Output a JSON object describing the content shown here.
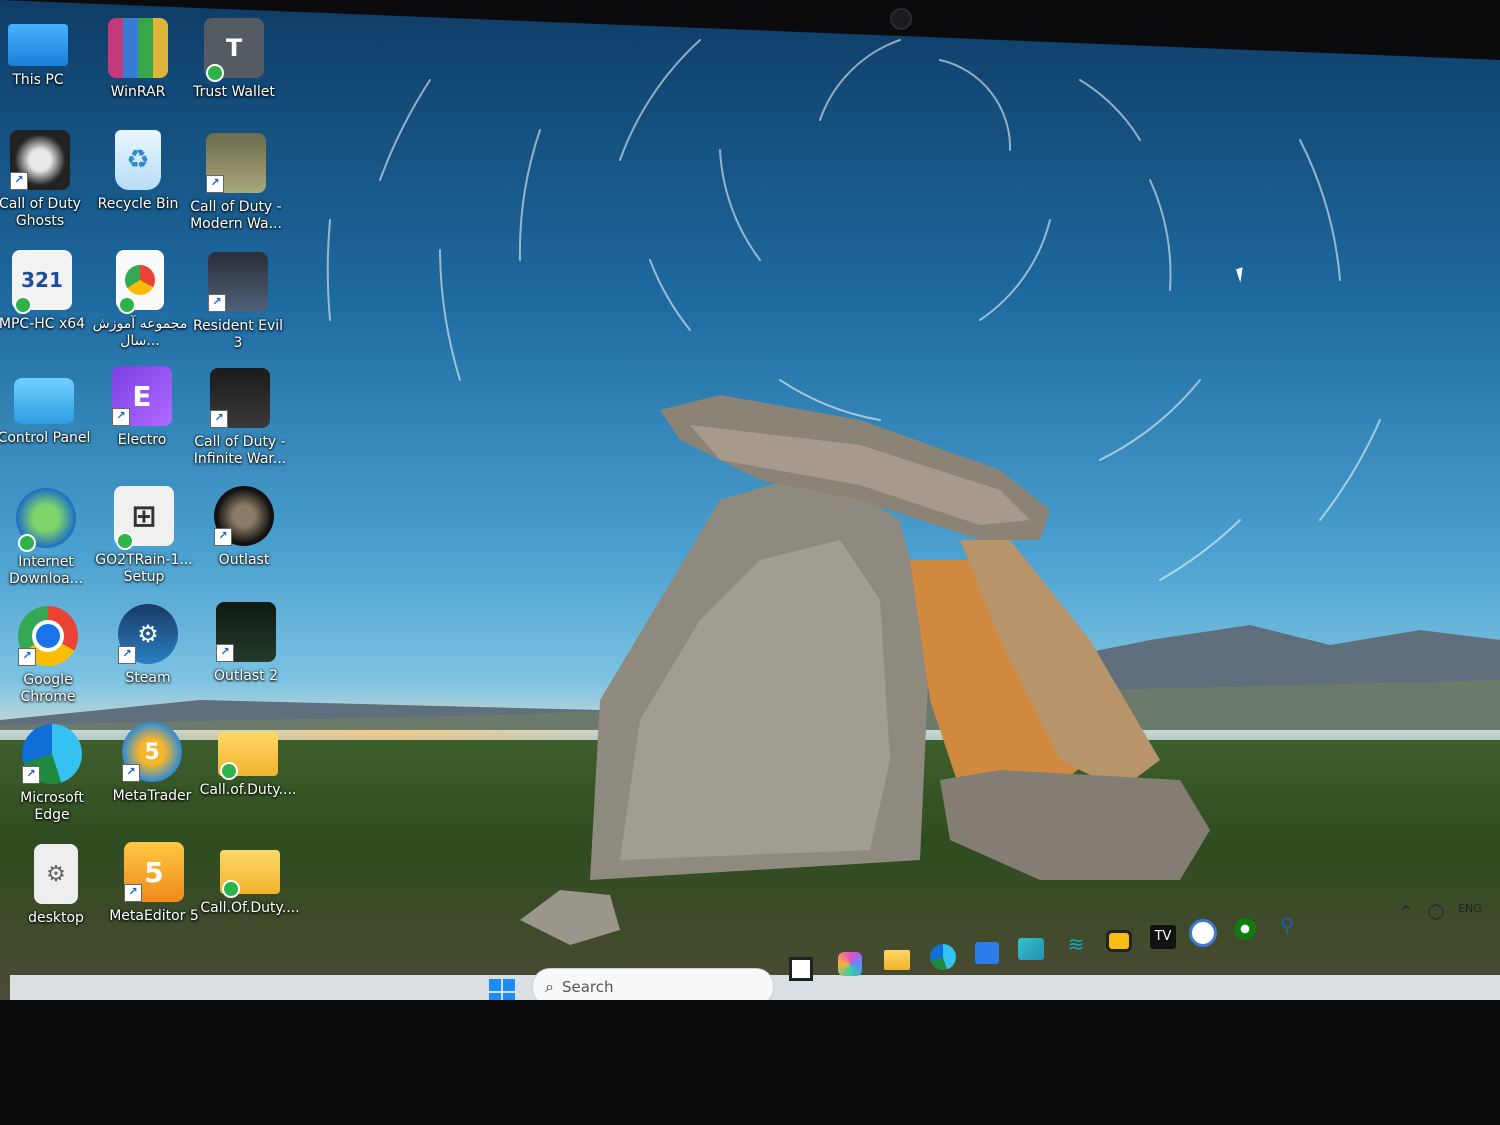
{
  "desktop": {
    "icons": [
      {
        "label": "This PC",
        "icon": "monitor-icon"
      },
      {
        "label": "WinRAR",
        "icon": "winrar-icon"
      },
      {
        "label": "Trust Wallet",
        "icon": "trust-wallet-icon",
        "glyph": "T"
      },
      {
        "label": "Call of Duty Ghosts",
        "icon": "cod-ghosts-icon"
      },
      {
        "label": "Recycle Bin",
        "icon": "recycle-bin-icon"
      },
      {
        "label": "Call of Duty - Modern Wa...",
        "icon": "cod-mw-icon"
      },
      {
        "label": "MPC-HC x64",
        "icon": "mpc-hc-icon",
        "glyph": "321"
      },
      {
        "label": "مجموعه آموزش سال...",
        "icon": "chrome-file-icon"
      },
      {
        "label": "Resident Evil 3",
        "icon": "resident-evil-icon"
      },
      {
        "label": "Control Panel",
        "icon": "control-panel-icon"
      },
      {
        "label": "Electro",
        "icon": "electro-icon",
        "glyph": "E"
      },
      {
        "label": "Call of Duty - Infinite War...",
        "icon": "cod-iw-icon"
      },
      {
        "label": "Internet Downloa...",
        "icon": "idm-icon"
      },
      {
        "label": "GO2TRain-1... Setup",
        "icon": "installer-icon"
      },
      {
        "label": "Outlast",
        "icon": "outlast-icon"
      },
      {
        "label": "Google Chrome",
        "icon": "chrome-icon"
      },
      {
        "label": "Steam",
        "icon": "steam-icon"
      },
      {
        "label": "Outlast 2",
        "icon": "outlast2-icon"
      },
      {
        "label": "Microsoft Edge",
        "icon": "edge-icon"
      },
      {
        "label": "MetaTrader",
        "icon": "metatrader-icon",
        "glyph": "5"
      },
      {
        "label": "Call.of.Duty....",
        "icon": "folder-icon"
      },
      {
        "label": "desktop",
        "icon": "desktop-file-icon"
      },
      {
        "label": "MetaEditor 5",
        "icon": "metaeditor-icon",
        "glyph": "5"
      },
      {
        "label": "Call.Of.Duty....",
        "icon": "folder-icon"
      }
    ]
  },
  "taskbar": {
    "search_placeholder": "Search",
    "pinned": [
      "task-view-icon",
      "copilot-icon",
      "file-explorer-icon",
      "edge-icon",
      "store-icon",
      "photos-icon",
      "wifi-app-icon",
      "app-yellow-icon",
      "tv-app-icon",
      "vpn-icon",
      "xbox-icon",
      "bike-app-icon"
    ],
    "tv_glyph": "TV",
    "language": "ENG"
  },
  "colors": {
    "accent": "#0a74da",
    "folder": "#f4c542"
  }
}
